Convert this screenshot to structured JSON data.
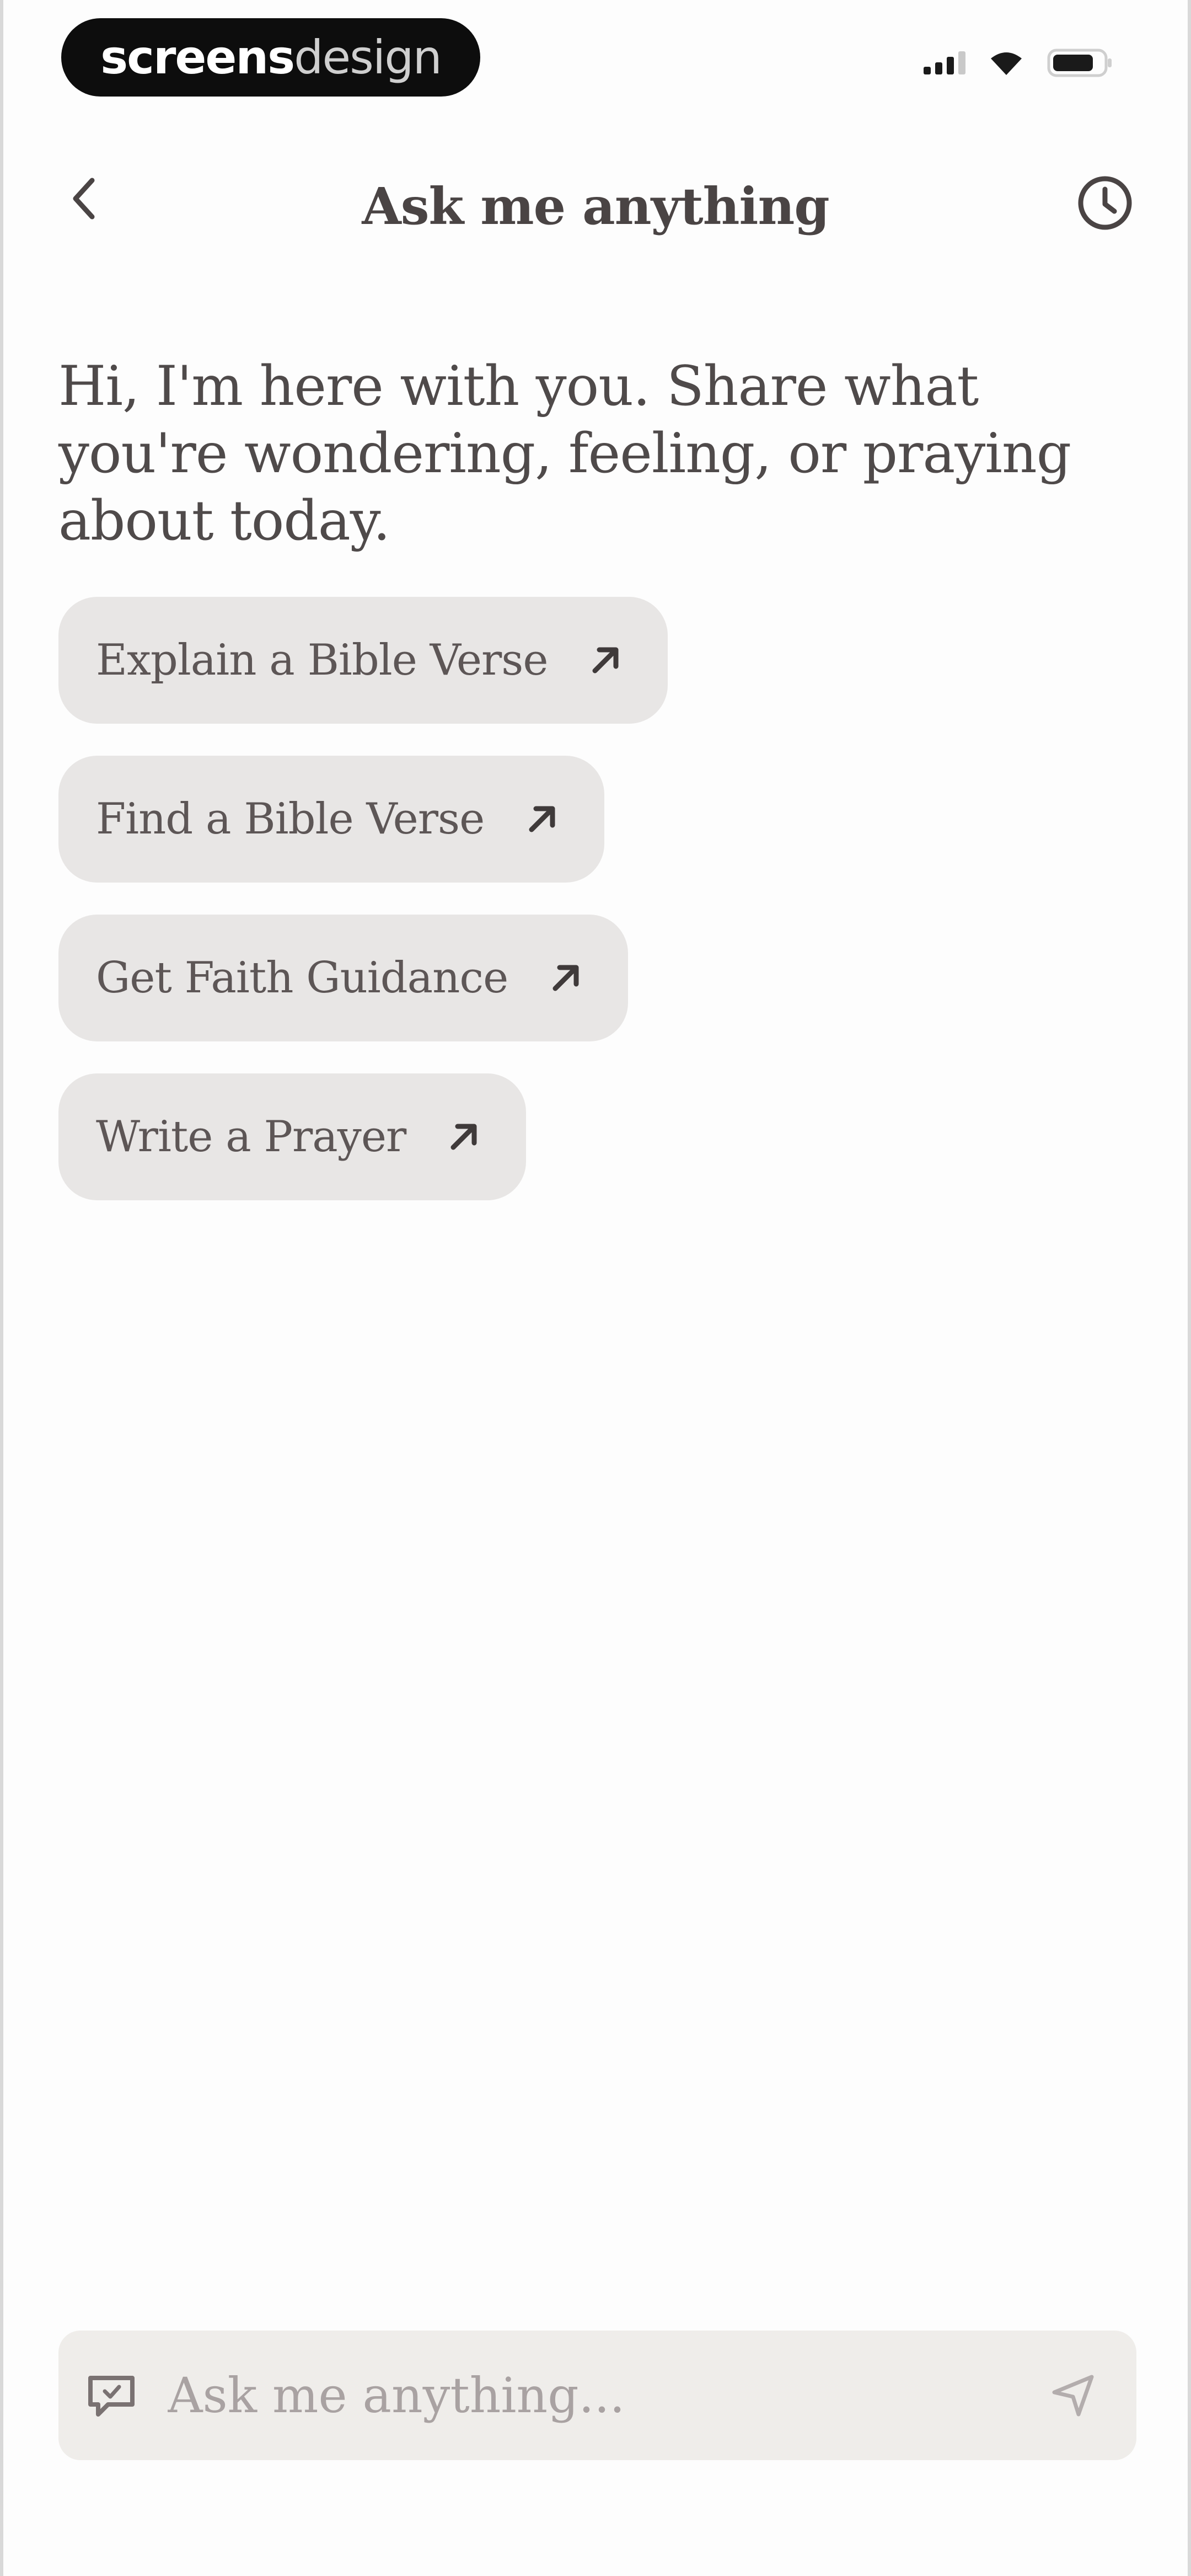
{
  "status_bar": {
    "brand_part1": "screens",
    "brand_part2": "design"
  },
  "header": {
    "title": "Ask me anything"
  },
  "intro": {
    "text": "Hi, I'm here with you. Share what you're wondering, feeling, or praying about today."
  },
  "suggestions": [
    {
      "label": "Explain a Bible Verse"
    },
    {
      "label": "Find a Bible Verse"
    },
    {
      "label": "Get Faith Guidance"
    },
    {
      "label": "Write a Prayer"
    }
  ],
  "input": {
    "placeholder": "Ask me anything...",
    "value": ""
  },
  "icons": {
    "back": "chevron-left-icon",
    "history": "clock-icon",
    "suggestion_arrow": "arrow-up-right-icon",
    "chat": "chat-bubble-icon",
    "send": "send-icon"
  },
  "colors": {
    "chip_background": "#e8e6e5",
    "input_background": "#efedea",
    "text": "#4f4a4a"
  }
}
